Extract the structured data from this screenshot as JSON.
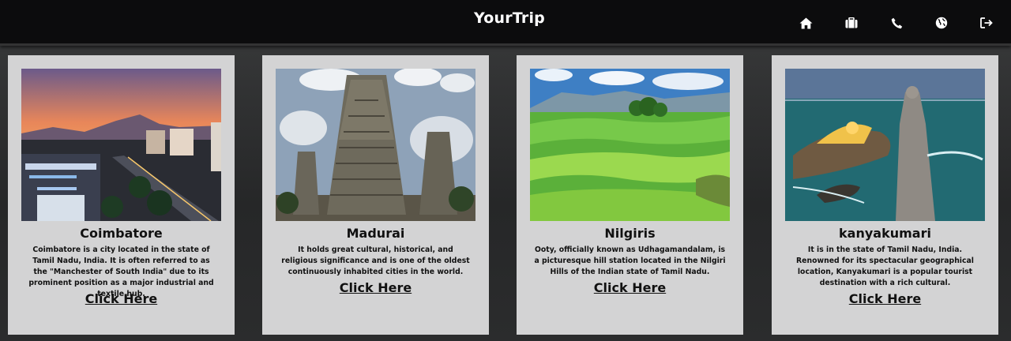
{
  "header": {
    "brand": "YourTrip",
    "nav": [
      {
        "icon": "home-icon"
      },
      {
        "icon": "briefcase-icon"
      },
      {
        "icon": "phone-icon"
      },
      {
        "icon": "globe-icon"
      },
      {
        "icon": "logout-icon"
      }
    ]
  },
  "cards": [
    {
      "title": "Coimbatore",
      "description": "Coimbatore is a city located in the state of Tamil Nadu, India. It is often referred to as the \"Manchester of South India\" due to its prominent position as a major industrial and textile hub.",
      "link_label": "Click Here",
      "image": "Coimbatore city skyline at sunset"
    },
    {
      "title": "Madurai",
      "description": "It holds great cultural, historical, and religious significance and is one of the oldest continuously inhabited cities in the world.",
      "link_label": "Click Here",
      "image": "Madurai temple gopuram"
    },
    {
      "title": "Nilgiris",
      "description": "Ooty, officially known as Udhagamandalam, is a picturesque hill station located in the Nilgiri Hills of the Indian state of Tamil Nadu.",
      "link_label": "Click Here",
      "image": "Nilgiris tea plantations"
    },
    {
      "title": "kanyakumari",
      "description": "It is in the state of Tamil Nadu, India. Renowned for its spectacular geographical location, Kanyakumari is a popular tourist destination with a rich cultural.",
      "link_label": "Click Here",
      "image": "Kanyakumari statue and sea"
    }
  ],
  "colors": {
    "header_bg": "#0c0c0d",
    "card_bg": "#d3d3d4",
    "page_bg": "#2b2c2d",
    "text": "#111111"
  }
}
